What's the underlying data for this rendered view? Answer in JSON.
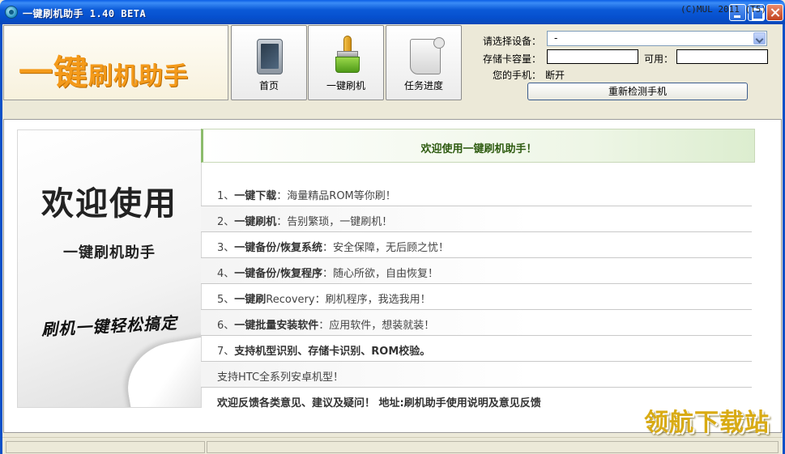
{
  "window": {
    "title": "一键刷机助手 1.40 BETA"
  },
  "logo": {
    "text_big": "一键",
    "text_small": "刷机助手"
  },
  "toolbar": {
    "buttons": [
      {
        "label": "首页",
        "icon": "tablet-icon"
      },
      {
        "label": "一键刷机",
        "icon": "brush-icon"
      },
      {
        "label": "任务进度",
        "icon": "scroll-icon"
      }
    ]
  },
  "device": {
    "select_label": "请选择设备：",
    "select_value": "-",
    "storage_label": "存储卡容量：",
    "storage_value": "",
    "available_label": "可用：",
    "available_value": "",
    "phone_label": "您的手机：",
    "phone_status": "断开",
    "redetect_label": "重新检测手机"
  },
  "welcome": {
    "banner": "欢迎使用一键刷机助手！",
    "card_title": "欢迎使用",
    "card_subtitle": "一键刷机助手",
    "card_slogan": "刷机一键轻松搞定"
  },
  "features": [
    {
      "prefix": "1、",
      "bold": "一键下载",
      "rest": "：海量精品ROM等你刷！"
    },
    {
      "prefix": "2、",
      "bold": "一键刷机",
      "rest": "：告别繁琐，一键刷机！"
    },
    {
      "prefix": "3、",
      "bold": "一键备份/恢复系统",
      "rest": "：安全保障，无后顾之忧！"
    },
    {
      "prefix": "4、",
      "bold": "一键备份/恢复程序",
      "rest": "：随心所欲，自由恢复！"
    },
    {
      "prefix": "5、",
      "bold": "一键刷",
      "rest": "Recovery：刷机程序，我选我用！"
    },
    {
      "prefix": "6、",
      "bold": "一键批量安装软件",
      "rest": "：应用软件，想装就装！"
    },
    {
      "prefix": "7、",
      "bold": "支持机型识别、存储卡识别、ROM校验。",
      "rest": ""
    }
  ],
  "support_note": "支持HTC全系列安卓机型！",
  "feedback": {
    "text": "欢迎反馈各类意见、建议及疑问！ 地址:",
    "link": "刷机助手使用说明及意见反馈"
  },
  "watermark": "领航下载站",
  "statusbar": {
    "copyright": "(C)MUL 2011 (T5)"
  }
}
